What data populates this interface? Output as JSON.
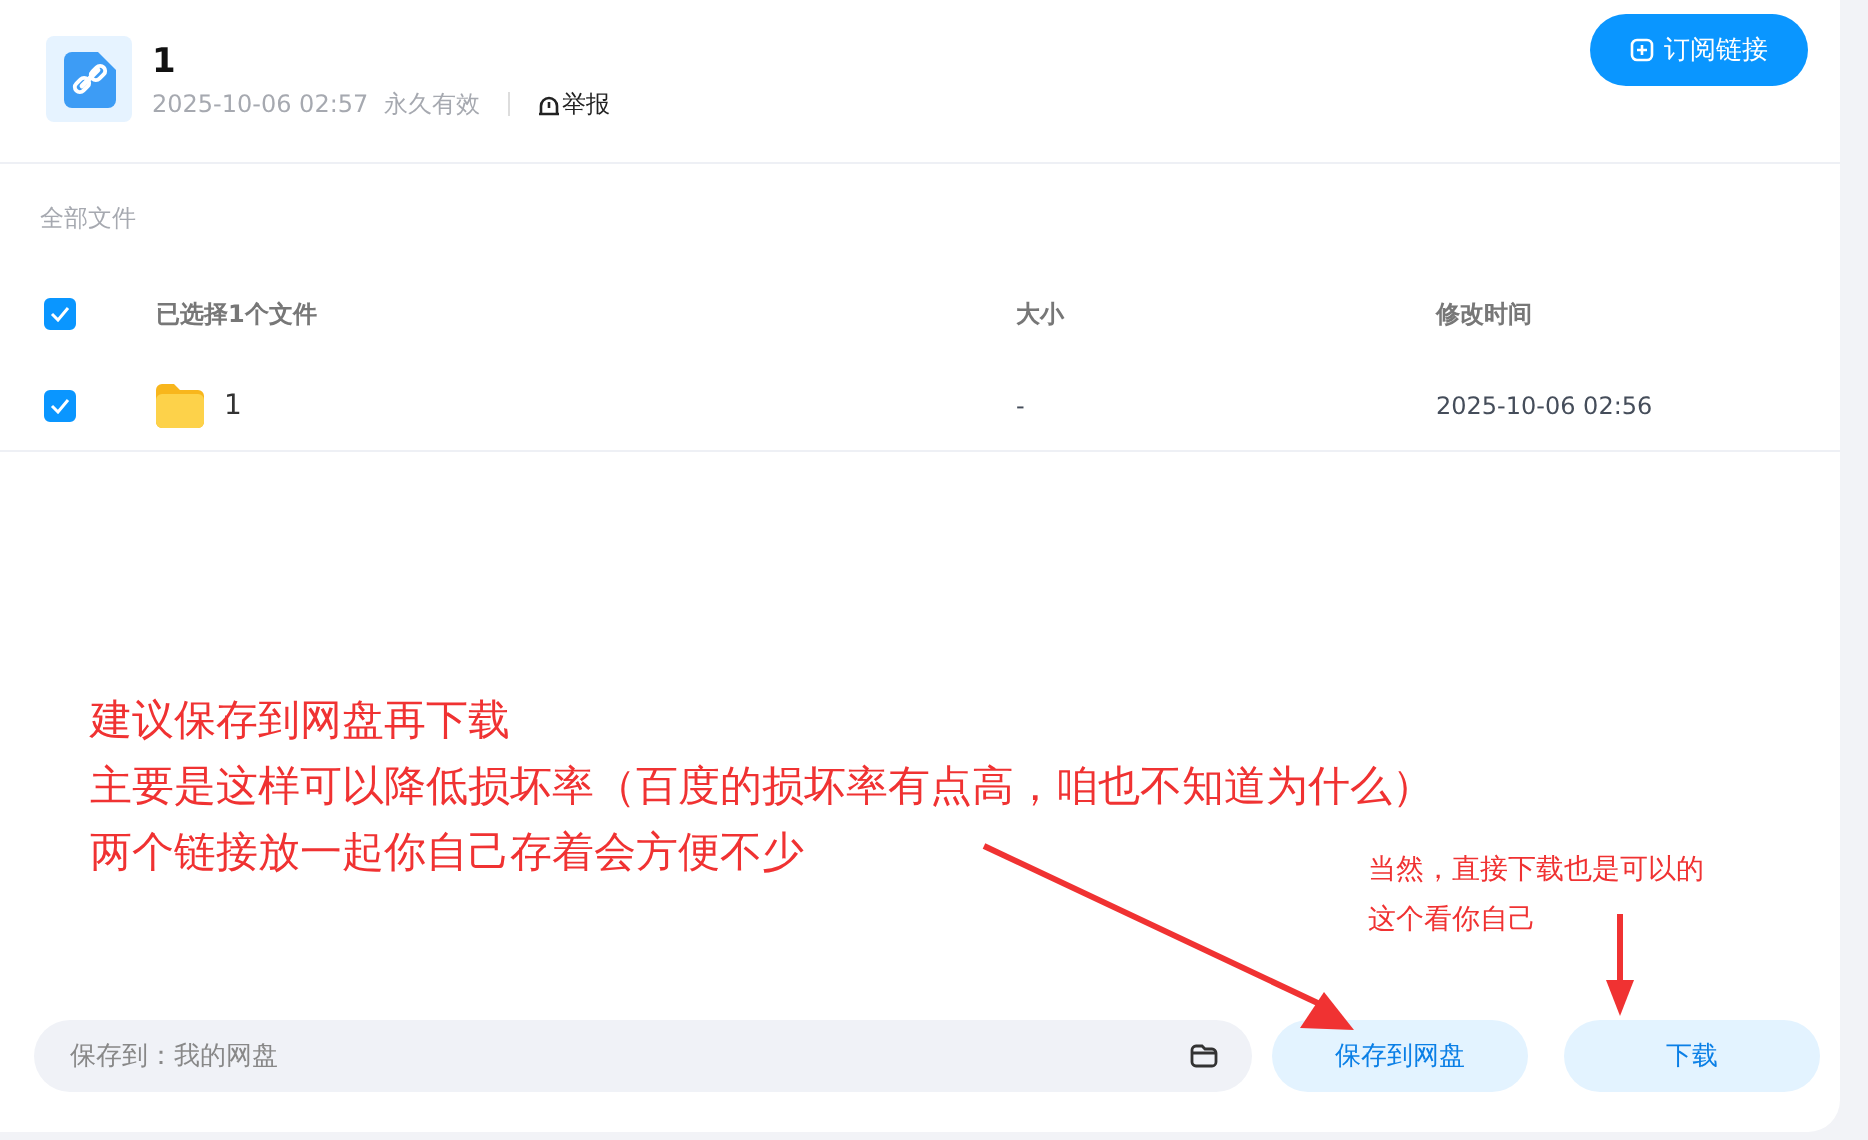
{
  "share": {
    "title": "1",
    "time": "2025-10-06 02:57",
    "validity": "永久有效",
    "report": "举报",
    "subscribe": "订阅链接"
  },
  "breadcrumb": "全部文件",
  "table": {
    "select_all": {
      "label": "已选择1个文件",
      "checked": true
    },
    "columns": [
      "大小",
      "修改时间"
    ],
    "rows": [
      {
        "name": "1",
        "kind": "folder",
        "size": "-",
        "modified": "2025-10-06 02:56",
        "checked": true
      }
    ]
  },
  "save_bar": {
    "label": "保存到：我的网盘",
    "save_button": "保存到网盘",
    "download_button": "下载"
  },
  "annotations": {
    "main": [
      "建议保存到网盘再下载",
      "主要是这样可以降低损坏率（百度的损坏率有点高，咱也不知道为什么）",
      "两个链接放一起你自己存着会方便不少"
    ],
    "side": [
      "当然，直接下载也是可以的",
      "这个看你自己"
    ]
  }
}
